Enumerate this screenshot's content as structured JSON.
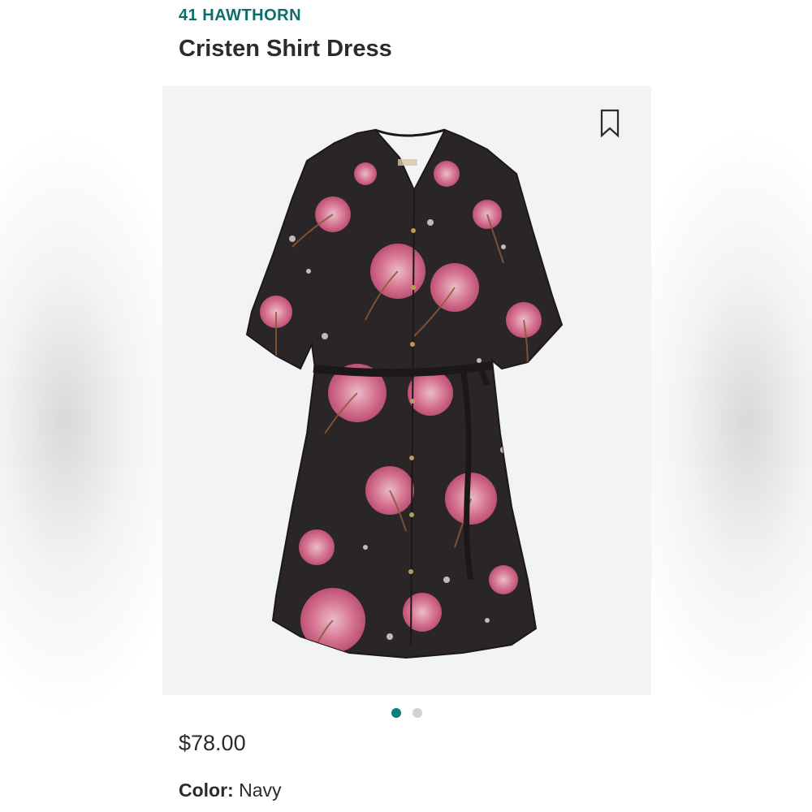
{
  "product": {
    "brand": "41 HAWTHORN",
    "name": "Cristen Shirt Dress",
    "price": "$78.00",
    "color_label": "Color:",
    "color_value": "Navy"
  },
  "gallery": {
    "image_count": 2,
    "active_index": 0,
    "bookmark_icon": "bookmark-icon"
  },
  "colors": {
    "accent": "#0b7f7a",
    "brand_text": "#0b6e6a",
    "image_bg": "#f2f3f5",
    "dress_body": "#2a2526",
    "flower_pink": "#e58aa6"
  }
}
